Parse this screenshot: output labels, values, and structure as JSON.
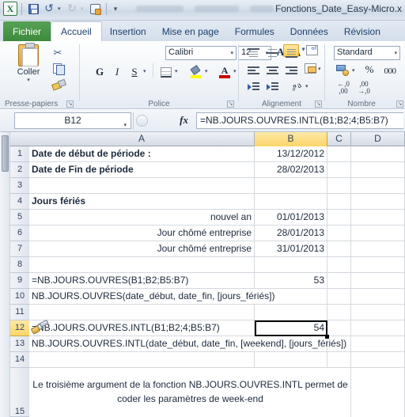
{
  "window": {
    "title": "Fonctions_Date_Easy-Micro.x",
    "quick_access": [
      {
        "name": "excel-logo",
        "label": "X"
      },
      {
        "name": "save-icon",
        "label": "Enregistrer"
      },
      {
        "name": "undo-icon",
        "label": "Annuler"
      },
      {
        "name": "redo-icon",
        "label": "Rétablir"
      },
      {
        "name": "print-preview-icon",
        "label": "Aperçu et impression"
      },
      {
        "name": "customize-qat-icon",
        "label": "Personnaliser"
      }
    ]
  },
  "ribbon": {
    "tabs": [
      {
        "label": "Fichier",
        "active": false,
        "file": true
      },
      {
        "label": "Accueil",
        "active": true,
        "file": false
      },
      {
        "label": "Insertion",
        "active": false,
        "file": false
      },
      {
        "label": "Mise en page",
        "active": false,
        "file": false
      },
      {
        "label": "Formules",
        "active": false,
        "file": false
      },
      {
        "label": "Données",
        "active": false,
        "file": false
      },
      {
        "label": "Révision",
        "active": false,
        "file": false
      }
    ],
    "groups": {
      "clipboard": {
        "label": "Presse-papiers",
        "paste_label": "Coller",
        "cut_label": "Couper",
        "copy_label": "Copier",
        "format_painter_label": "Reproduire la mise en forme"
      },
      "font": {
        "label": "Police",
        "font_name": "Calibri",
        "font_size": "12",
        "bold_label": "G",
        "italic_label": "I",
        "underline_label": "S",
        "grow_label": "A",
        "shrink_label": "A",
        "borders_label": "Bordures",
        "fill_color_label": "Couleur de remplissage",
        "fill_color": "#ffff00",
        "font_color_label": "Couleur de police",
        "font_color": "#cc0000"
      },
      "alignment": {
        "label": "Alignement",
        "align_top_label": "Aligner en haut",
        "align_middle_label": "Aligner au centre",
        "align_bottom_label": "Aligner en bas",
        "align_left_label": "Aligner à gauche",
        "align_center_label": "Centrer",
        "align_right_label": "Aligner à droite",
        "wrap_text_label": "Renvoyer à la ligne automatiquement",
        "merge_label": "Fusionner et centrer",
        "decrease_indent_label": "Diminuer le retrait",
        "increase_indent_label": "Augmenter le retrait",
        "orientation_label": "Orientation"
      },
      "number": {
        "label": "Nombre",
        "format": "Standard",
        "currency_label": "Format Comptabilité",
        "percent_label": "%",
        "thousands_label": "000",
        "add_decimal_label": ",00",
        "remove_decimal_label": ",00"
      }
    }
  },
  "formula_bar": {
    "name_box": "B12",
    "fx_label": "fx",
    "formula": "=NB.JOURS.OUVRES.INTL(B1;B2;4;B5:B7)"
  },
  "sheet": {
    "columns": [
      {
        "label": "A",
        "selected": false
      },
      {
        "label": "B",
        "selected": true
      },
      {
        "label": "C",
        "selected": false
      },
      {
        "label": "D",
        "selected": false
      }
    ],
    "selected_cell": "B12",
    "rows": [
      {
        "num": "1",
        "selected": false,
        "a": "Date de début de période :",
        "a_bold": true,
        "a_align": "left",
        "b": "13/12/2012",
        "c": "",
        "d": ""
      },
      {
        "num": "2",
        "selected": false,
        "a": "Date de Fin de période",
        "a_bold": true,
        "a_align": "left",
        "b": "28/02/2013",
        "c": "",
        "d": ""
      },
      {
        "num": "3",
        "selected": false,
        "a": "",
        "a_bold": false,
        "a_align": "left",
        "b": "",
        "c": "",
        "d": ""
      },
      {
        "num": "4",
        "selected": false,
        "a": "Jours fériés",
        "a_bold": true,
        "a_align": "left",
        "b": "",
        "c": "",
        "d": ""
      },
      {
        "num": "5",
        "selected": false,
        "a": "nouvel an",
        "a_bold": false,
        "a_align": "right",
        "b": "01/01/2013",
        "c": "",
        "d": ""
      },
      {
        "num": "6",
        "selected": false,
        "a": "Jour chômé entreprise",
        "a_bold": false,
        "a_align": "right",
        "b": "28/01/2013",
        "c": "",
        "d": ""
      },
      {
        "num": "7",
        "selected": false,
        "a": "Jour chômé entreprise",
        "a_bold": false,
        "a_align": "right",
        "b": "31/01/2013",
        "c": "",
        "d": ""
      },
      {
        "num": "8",
        "selected": false,
        "a": "",
        "a_bold": false,
        "a_align": "left",
        "b": "",
        "c": "",
        "d": ""
      },
      {
        "num": "9",
        "selected": false,
        "a": "=NB.JOURS.OUVRES(B1;B2;B5:B7)",
        "a_bold": false,
        "a_align": "left",
        "b": "53",
        "c": "",
        "d": ""
      },
      {
        "num": "10",
        "selected": false,
        "a": "NB.JOURS.OUVRES(date_début, date_fin, [jours_fériés])",
        "a_bold": false,
        "a_align": "left",
        "b": "",
        "c": "",
        "d": ""
      },
      {
        "num": "11",
        "selected": false,
        "a": "",
        "a_bold": false,
        "a_align": "left",
        "b": "",
        "c": "",
        "d": ""
      },
      {
        "num": "12",
        "selected": true,
        "a": "=NB.JOURS.OUVRES.INTL(B1;B2;4;B5:B7)",
        "a_bold": false,
        "a_align": "left",
        "b": "54",
        "c": "",
        "d": ""
      },
      {
        "num": "13",
        "selected": false,
        "a": "NB.JOURS.OUVRES.INTL(date_début, date_fin, [weekend], [jours_fériés])",
        "a_bold": false,
        "a_align": "left",
        "b": "",
        "c": "",
        "d": ""
      },
      {
        "num": "14",
        "selected": false,
        "a": "",
        "a_bold": false,
        "a_align": "left",
        "b": "",
        "c": "",
        "d": ""
      },
      {
        "num": "15",
        "selected": false,
        "a": "Le troisième argument de la fonction NB.JOURS.OUVRES.INTL permet de coder les paramètres de week-end",
        "a_bold": false,
        "a_align": "center",
        "b": "",
        "c": "",
        "d": ""
      }
    ]
  },
  "cursor": {
    "name": "format-painter-cursor",
    "label": "Reproduire la mise en forme"
  }
}
